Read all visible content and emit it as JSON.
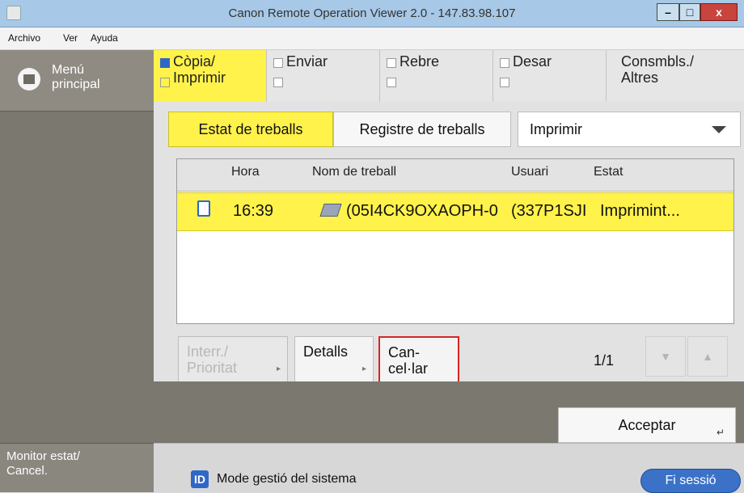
{
  "window": {
    "title": "Canon Remote Operation Viewer 2.0 - 147.83.98.107",
    "minimize": "–",
    "maximize": "□",
    "close": "x"
  },
  "menubar": {
    "items": [
      {
        "label": "Archivo"
      },
      {
        "label": "Ver"
      },
      {
        "label": "Ayuda"
      }
    ]
  },
  "sidebar": {
    "main_menu_line1": "Menú",
    "main_menu_line2": "principal",
    "monitor_line1": "Monitor estat/",
    "monitor_line2": "Cancel."
  },
  "tabs": [
    {
      "line1": "Còpia/",
      "line2": "Imprimir",
      "active": true
    },
    {
      "line1": "Enviar",
      "line2": ""
    },
    {
      "line1": "Rebre",
      "line2": ""
    },
    {
      "line1": "Desar",
      "line2": ""
    },
    {
      "line1": "Consmbls./",
      "line2": "Altres"
    }
  ],
  "segments": {
    "status": "Estat de treballs",
    "log": "Registre de treballs"
  },
  "dropdown": {
    "value": "Imprimir"
  },
  "joblist": {
    "headers": {
      "time": "Hora",
      "name": "Nom de treball",
      "user": "Usuari",
      "state": "Estat"
    },
    "rows": [
      {
        "time": "16:39",
        "name": "(05I4CK9OXAOPH-0",
        "user": "(337P1SJI",
        "state": "Imprimint..."
      }
    ]
  },
  "buttons": {
    "interrupt_line1": "Interr./",
    "interrupt_line2": "Prioritat",
    "details": "Detalls",
    "cancel_line1": "Can-",
    "cancel_line2": "cel·lar",
    "page": "1/1",
    "accept": "Acceptar"
  },
  "statusbar": {
    "icon_text": "ID",
    "label": "Mode gestió del sistema",
    "logout": "Fi sessió"
  },
  "colors": {
    "accent_yellow": "#fff24a",
    "brand_blue": "#2f67c7",
    "highlight_red": "#d42626"
  }
}
